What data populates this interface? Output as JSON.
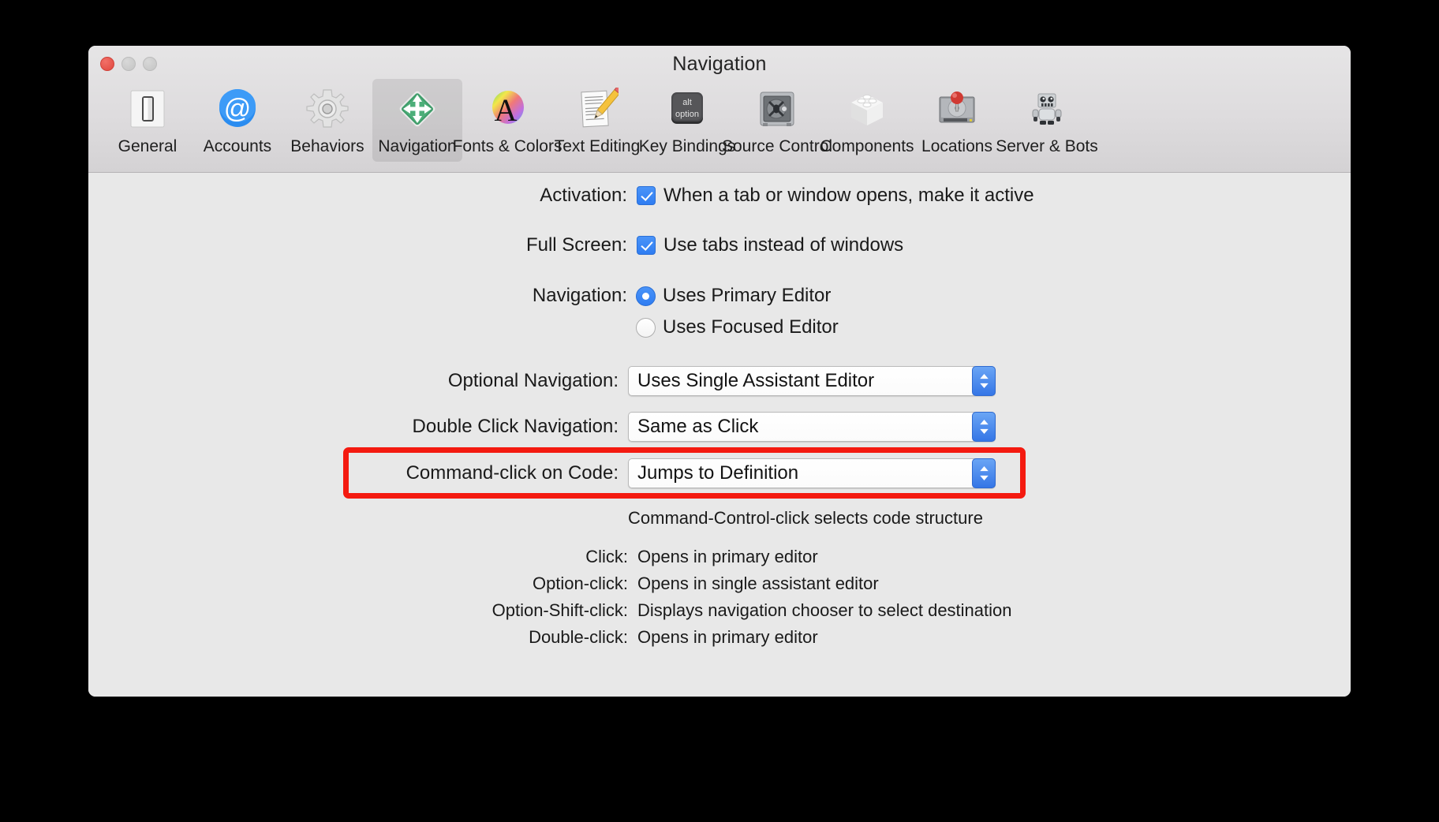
{
  "window": {
    "title": "Navigation",
    "traffic_lights": [
      {
        "name": "close",
        "color": "#e0483f"
      },
      {
        "name": "minimize",
        "color": "#c4c4c4"
      },
      {
        "name": "zoom",
        "color": "#c4c4c4"
      }
    ]
  },
  "toolbar": {
    "selected": "Navigation",
    "tabs": [
      {
        "label": "General",
        "icon": "light-switch-icon"
      },
      {
        "label": "Accounts",
        "icon": "at-sign-icon"
      },
      {
        "label": "Behaviors",
        "icon": "gear-icon"
      },
      {
        "label": "Navigation",
        "icon": "four-way-arrow-icon"
      },
      {
        "label": "Fonts & Colors",
        "icon": "color-wheel-letter-a-icon"
      },
      {
        "label": "Text Editing",
        "icon": "document-pencil-icon"
      },
      {
        "label": "Key Bindings",
        "icon": "alt-option-key-icon"
      },
      {
        "label": "Source Control",
        "icon": "safe-vault-icon"
      },
      {
        "label": "Components",
        "icon": "cube-block-icon"
      },
      {
        "label": "Locations",
        "icon": "hard-drive-pin-icon"
      },
      {
        "label": "Server & Bots",
        "icon": "robot-icon"
      }
    ]
  },
  "key_icon": {
    "line1": "alt",
    "line2": "option"
  },
  "settings": {
    "activation": {
      "label": "Activation:",
      "checkbox_label": "When a tab or window opens, make it active",
      "checked": true
    },
    "full_screen": {
      "label": "Full Screen:",
      "checkbox_label": "Use tabs instead of windows",
      "checked": true
    },
    "navigation": {
      "label": "Navigation:",
      "options": [
        {
          "label": "Uses Primary Editor",
          "selected": true
        },
        {
          "label": "Uses Focused Editor",
          "selected": false
        }
      ]
    },
    "optional_navigation": {
      "label": "Optional Navigation:",
      "value": "Uses Single Assistant Editor"
    },
    "double_click_navigation": {
      "label": "Double Click Navigation:",
      "value": "Same as Click"
    },
    "command_click_on_code": {
      "label": "Command-click on Code:",
      "value": "Jumps to Definition",
      "hint": "Command-Control-click selects code structure",
      "highlight_color": "#f41a10"
    }
  },
  "behaviors": [
    {
      "label": "Click:",
      "value": "Opens in primary editor"
    },
    {
      "label": "Option-click:",
      "value": "Opens in single assistant editor"
    },
    {
      "label": "Option-Shift-click:",
      "value": "Displays navigation chooser to select destination"
    },
    {
      "label": "Double-click:",
      "value": "Opens in primary editor"
    }
  ]
}
